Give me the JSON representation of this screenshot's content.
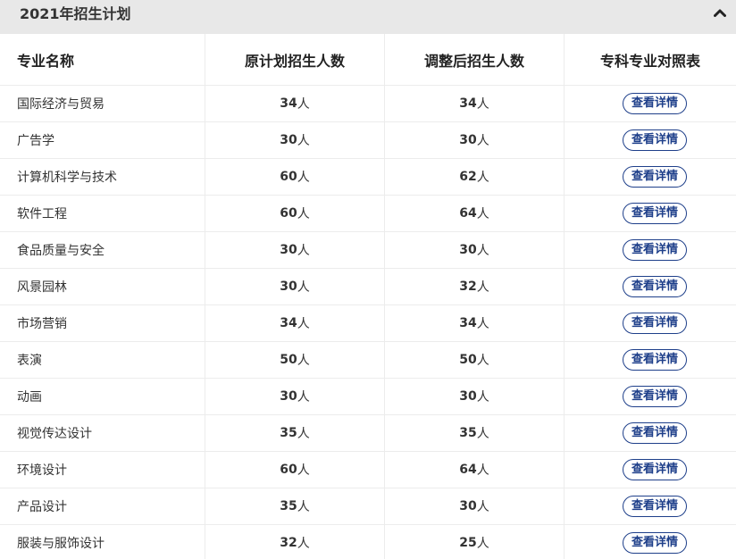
{
  "panel": {
    "title": "2021年招生计划",
    "collapse_icon": "chevron-up-icon"
  },
  "table": {
    "headers": [
      "专业名称",
      "原计划招生人数",
      "调整后招生人数",
      "专科专业对照表"
    ],
    "button_label": "查看详情",
    "rows": [
      {
        "major": "国际经济与贸易",
        "planned_num": "34",
        "planned_unit": "人",
        "adjusted_num": "34",
        "adjusted_unit": "人"
      },
      {
        "major": "广告学",
        "planned_num": "30",
        "planned_unit": "人",
        "adjusted_num": "30",
        "adjusted_unit": "人"
      },
      {
        "major": "计算机科学与技术",
        "planned_num": "60",
        "planned_unit": "人",
        "adjusted_num": "62",
        "adjusted_unit": "人"
      },
      {
        "major": "软件工程",
        "planned_num": "60",
        "planned_unit": "人",
        "adjusted_num": "64",
        "adjusted_unit": "人"
      },
      {
        "major": "食品质量与安全",
        "planned_num": "30",
        "planned_unit": "人",
        "adjusted_num": "30",
        "adjusted_unit": "人"
      },
      {
        "major": "风景园林",
        "planned_num": "30",
        "planned_unit": "人",
        "adjusted_num": "32",
        "adjusted_unit": "人"
      },
      {
        "major": "市场营销",
        "planned_num": "34",
        "planned_unit": "人",
        "adjusted_num": "34",
        "adjusted_unit": "人"
      },
      {
        "major": "表演",
        "planned_num": "50",
        "planned_unit": "人",
        "adjusted_num": "50",
        "adjusted_unit": "人"
      },
      {
        "major": "动画",
        "planned_num": "30",
        "planned_unit": "人",
        "adjusted_num": "30",
        "adjusted_unit": "人"
      },
      {
        "major": "视觉传达设计",
        "planned_num": "35",
        "planned_unit": "人",
        "adjusted_num": "35",
        "adjusted_unit": "人"
      },
      {
        "major": "环境设计",
        "planned_num": "60",
        "planned_unit": "人",
        "adjusted_num": "64",
        "adjusted_unit": "人"
      },
      {
        "major": "产品设计",
        "planned_num": "35",
        "planned_unit": "人",
        "adjusted_num": "30",
        "adjusted_unit": "人"
      },
      {
        "major": "服装与服饰设计",
        "planned_num": "32",
        "planned_unit": "人",
        "adjusted_num": "25",
        "adjusted_unit": "人"
      }
    ]
  },
  "colors": {
    "header_bg": "#e8e8e8",
    "button_accent": "#1e3f8a"
  }
}
